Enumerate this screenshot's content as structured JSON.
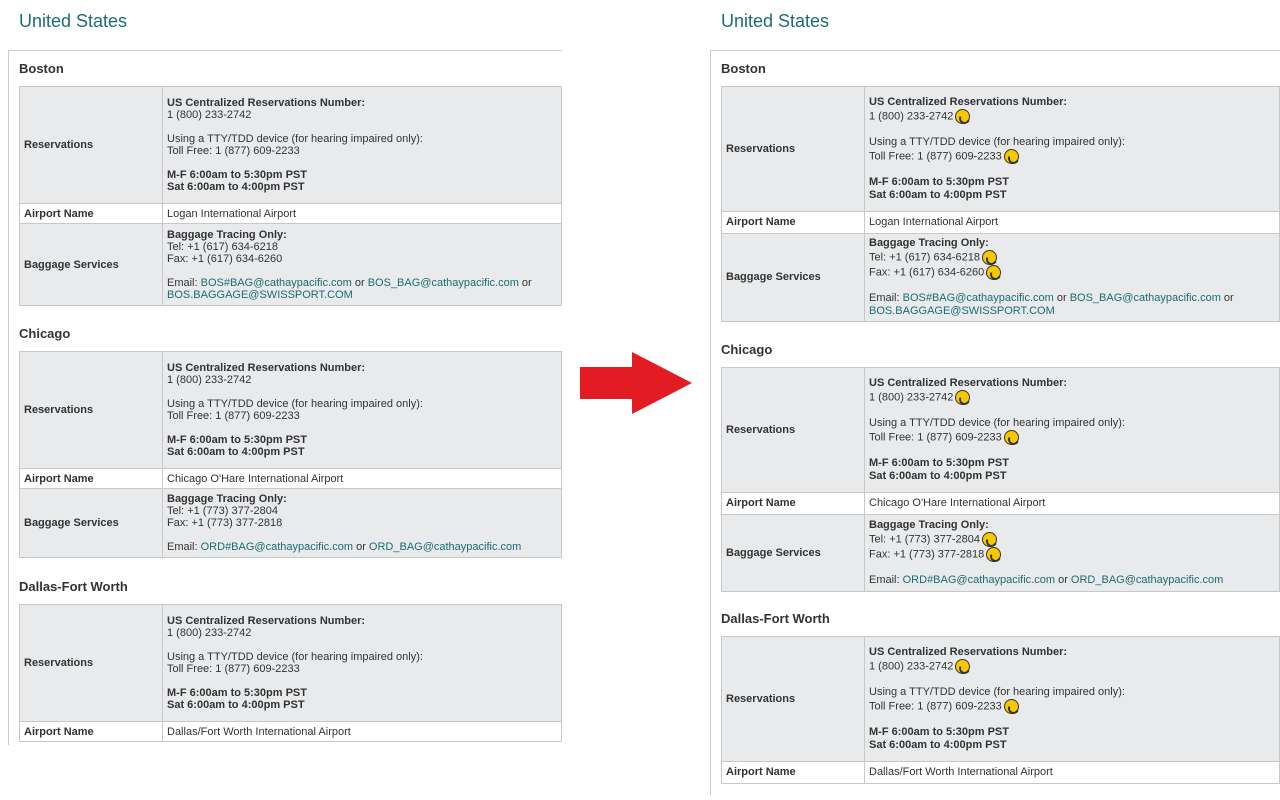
{
  "country": "United States",
  "labels": {
    "reservations": "Reservations",
    "airport_name": "Airport Name",
    "baggage_services": "Baggage Services"
  },
  "reservations": {
    "title": "US Centralized Reservations Number:",
    "number": "1 (800) 233-2742",
    "tty_label": "Using a TTY/TDD device (for hearing impaired only):",
    "toll_free_prefix": "Toll Free: ",
    "toll_free": "1 (877) 609-2233",
    "hours_weekday": "M-F 6:00am to 5:30pm PST",
    "hours_saturday": "Sat 6:00am to 4:00pm PST"
  },
  "baggage_title": "Baggage Tracing Only:",
  "tel_prefix": "Tel: ",
  "fax_prefix": "Fax: ",
  "email_prefix": "Email: ",
  "or_word": " or ",
  "cities": {
    "boston": {
      "name": "Boston",
      "airport": "Logan International Airport",
      "tel": "+1 (617) 634-6218",
      "fax": "+1 (617) 634-6260",
      "emails": [
        "BOS#BAG@cathaypacific.com",
        "BOS_BAG@cathaypacific.com",
        "BOS.BAGGAGE@SWISSPORT.COM"
      ]
    },
    "chicago": {
      "name": "Chicago",
      "airport": "Chicago O'Hare International Airport",
      "tel": "+1 (773) 377-2804",
      "fax": "+1 (773) 377-2818",
      "emails": [
        "ORD#BAG@cathaypacific.com",
        "ORD_BAG@cathaypacific.com"
      ]
    },
    "dallas": {
      "name": "Dallas-Fort Worth",
      "airport": "Dallas/Fort Worth International Airport"
    }
  },
  "icons": {
    "phone": "phone-icon",
    "arrow": "right-arrow-icon"
  },
  "colors": {
    "title": "#1a6d73",
    "link": "#1a6d73",
    "arrow": "#e31b23",
    "phone_icon": "#f7c800"
  }
}
